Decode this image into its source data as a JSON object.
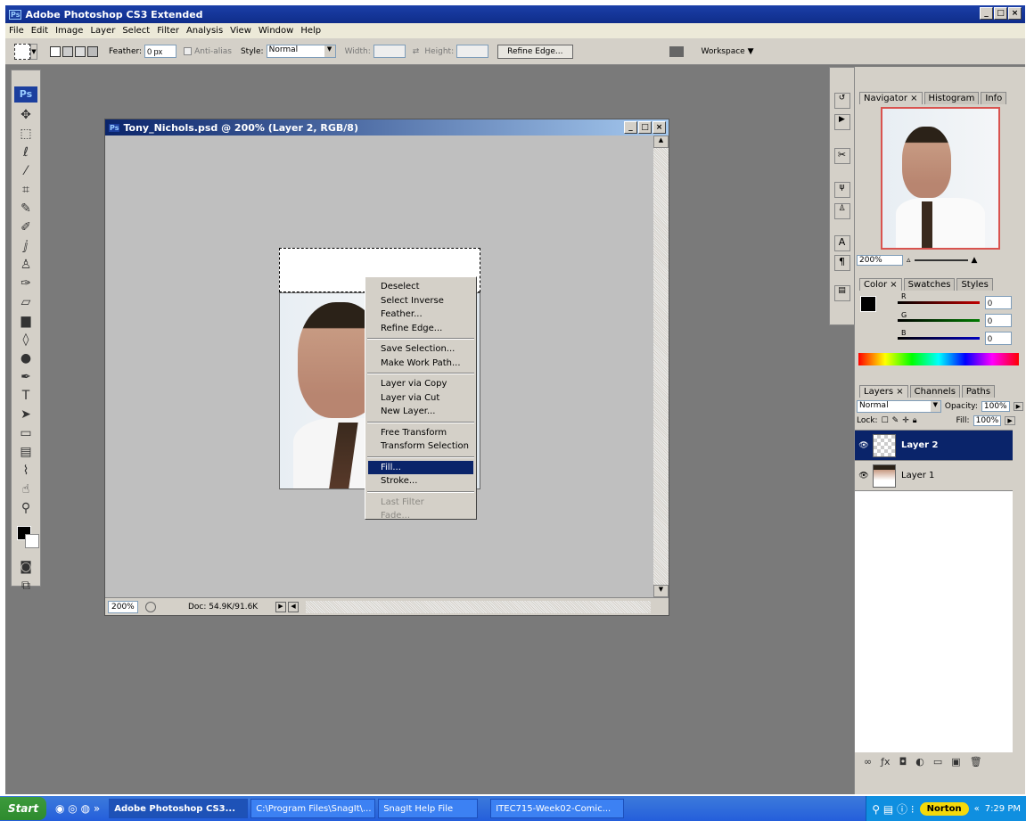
{
  "app": {
    "title": "Adobe Photoshop CS3 Extended",
    "logo": "Ps"
  },
  "menu": [
    "File",
    "Edit",
    "Image",
    "Layer",
    "Select",
    "Filter",
    "Analysis",
    "View",
    "Window",
    "Help"
  ],
  "options": {
    "feather_label": "Feather:",
    "feather_value": "0 px",
    "antialias_label": "Anti-alias",
    "style_label": "Style:",
    "style_value": "Normal",
    "width_label": "Width:",
    "height_label": "Height:",
    "refine_edge": "Refine Edge...",
    "workspace": "Workspace ▼"
  },
  "toolbox": {
    "logo": "Ps",
    "tools": [
      "move-tool-icon",
      "marquee-tool-icon",
      "lasso-tool-icon",
      "magic-wand-icon",
      "crop-tool-icon",
      "slice-tool-icon",
      "healing-brush-icon",
      "brush-tool-icon",
      "clone-stamp-icon",
      "history-brush-icon",
      "eraser-icon",
      "gradient-tool-icon",
      "blur-tool-icon",
      "dodge-tool-icon",
      "pen-tool-icon",
      "type-tool-icon",
      "path-selection-icon",
      "shape-tool-icon",
      "notes-tool-icon",
      "eyedropper-icon",
      "hand-tool-icon",
      "zoom-tool-icon"
    ]
  },
  "document": {
    "title": "Tony_Nichols.psd @ 200% (Layer 2, RGB/8)",
    "zoom": "200%",
    "doc_size": "Doc: 54.9K/91.6K"
  },
  "context_menu": {
    "groups": [
      [
        "Deselect",
        "Select Inverse",
        "Feather...",
        "Refine Edge..."
      ],
      [
        "Save Selection...",
        "Make Work Path..."
      ],
      [
        "Layer via Copy",
        "Layer via Cut",
        "New Layer..."
      ],
      [
        "Free Transform",
        "Transform Selection"
      ],
      [
        "Fill...",
        "Stroke..."
      ],
      [
        "Last Filter",
        "Fade..."
      ]
    ],
    "selected": "Fill..."
  },
  "navigator": {
    "tabs": [
      "Navigator ×",
      "Histogram",
      "Info"
    ],
    "zoom": "200%"
  },
  "color_panel": {
    "tabs": [
      "Color ×",
      "Swatches",
      "Styles"
    ],
    "r_label": "R",
    "r_value": "0",
    "g_label": "G",
    "g_value": "0",
    "b_label": "B",
    "b_value": "0",
    "colors": {
      "r": "#c00000",
      "g": "#007a00",
      "b": "#0000c0"
    }
  },
  "layers_panel": {
    "tabs": [
      "Layers ×",
      "Channels",
      "Paths"
    ],
    "blend_mode": "Normal",
    "opacity_label": "Opacity:",
    "opacity": "100%",
    "lock_label": "Lock:",
    "fill_label": "Fill:",
    "fill": "100%",
    "layers": [
      {
        "name": "Layer 2",
        "selected": true
      },
      {
        "name": "Layer 1",
        "selected": false
      }
    ]
  },
  "taskbar": {
    "start": "Start",
    "tasks": [
      {
        "label": "Adobe Photoshop CS3...",
        "active": true
      },
      {
        "label": "C:\\Program Files\\SnagIt\\...",
        "active": false
      },
      {
        "label": "SnagIt Help File",
        "active": false
      },
      {
        "label": "ITEC715-Week02-Comic...",
        "active": false
      }
    ],
    "norton": "Norton",
    "time": "7:29 PM"
  }
}
